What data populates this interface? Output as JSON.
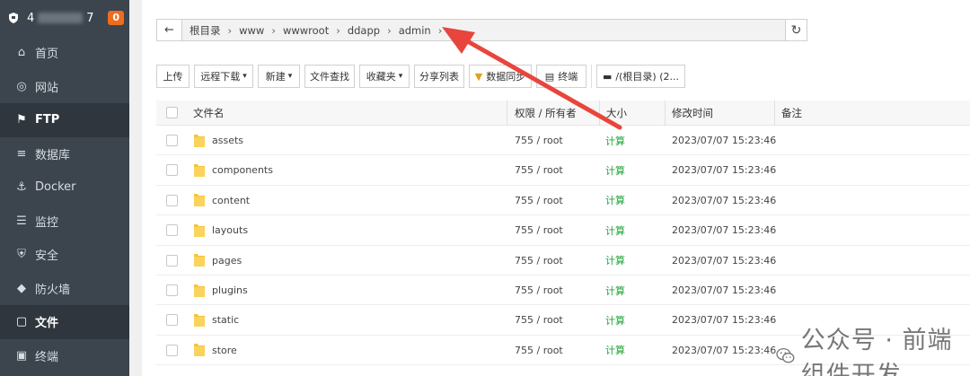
{
  "sidebar": {
    "account_prefix": "4",
    "account_suffix": "7",
    "badge": "0",
    "items": [
      {
        "label": "首页",
        "icon": "home-icon"
      },
      {
        "label": "网站",
        "icon": "globe-icon"
      },
      {
        "label": "FTP",
        "icon": "ftp-icon",
        "active": true
      },
      {
        "label": "数据库",
        "icon": "database-icon"
      },
      {
        "label": "Docker",
        "icon": "docker-icon"
      },
      {
        "label": "监控",
        "icon": "monitor-icon"
      },
      {
        "label": "安全",
        "icon": "shield-icon"
      },
      {
        "label": "防火墙",
        "icon": "firewall-icon"
      },
      {
        "label": "文件",
        "icon": "folder-icon",
        "active": true
      },
      {
        "label": "终端",
        "icon": "terminal-icon"
      }
    ]
  },
  "path": {
    "crumbs": [
      "根目录",
      "www",
      "wwwroot",
      "ddapp",
      "admin"
    ]
  },
  "toolbar": {
    "upload": "上传",
    "remote_download": "远程下载",
    "new": "新建",
    "file_search": "文件查找",
    "favorites": "收藏夹",
    "share_list": "分享列表",
    "sync": "数据同步",
    "terminal": "终端",
    "disk": "/(根目录) (2..."
  },
  "table": {
    "headers": {
      "name": "文件名",
      "perm": "权限 / 所有者",
      "size": "大小",
      "mtime": "修改时间",
      "note": "备注"
    },
    "rows": [
      {
        "name": "assets",
        "perm": "755 / root",
        "size": "计算",
        "mtime": "2023/07/07 15:23:46"
      },
      {
        "name": "components",
        "perm": "755 / root",
        "size": "计算",
        "mtime": "2023/07/07 15:23:46"
      },
      {
        "name": "content",
        "perm": "755 / root",
        "size": "计算",
        "mtime": "2023/07/07 15:23:46"
      },
      {
        "name": "layouts",
        "perm": "755 / root",
        "size": "计算",
        "mtime": "2023/07/07 15:23:46"
      },
      {
        "name": "pages",
        "perm": "755 / root",
        "size": "计算",
        "mtime": "2023/07/07 15:23:46"
      },
      {
        "name": "plugins",
        "perm": "755 / root",
        "size": "计算",
        "mtime": "2023/07/07 15:23:46"
      },
      {
        "name": "static",
        "perm": "755 / root",
        "size": "计算",
        "mtime": "2023/07/07 15:23:46"
      },
      {
        "name": "store",
        "perm": "755 / root",
        "size": "计算",
        "mtime": "2023/07/07 15:23:46"
      }
    ]
  },
  "watermark": "公众号 · 前端组件开发",
  "colors": {
    "sidebar_bg": "#3c444d",
    "accent_green": "#20a53a",
    "badge": "#ef6c1f",
    "arrow": "#e8453c"
  }
}
